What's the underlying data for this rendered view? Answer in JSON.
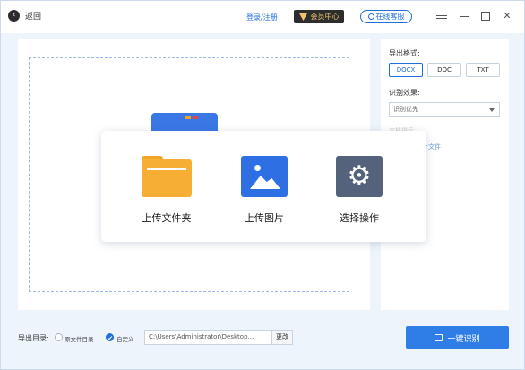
{
  "titlebar": {
    "back_label": "返回",
    "login_label": "登录/注册",
    "vip_label": "会员中心",
    "service_label": "在线客服"
  },
  "settings": {
    "export_format_label": "导出格式:",
    "formats": [
      "DOCX",
      "DOC",
      "TXT"
    ],
    "selected_format": "DOCX",
    "effect_label": "识别效果:",
    "effect_value": "识别优先",
    "partial_label": "文档提示",
    "partial_link": "个文件"
  },
  "popup": {
    "options": [
      {
        "label": "上传文件夹",
        "icon": "folder-icon"
      },
      {
        "label": "上传图片",
        "icon": "image-icon"
      },
      {
        "label": "选择操作",
        "icon": "gear-icon"
      }
    ]
  },
  "bottom": {
    "output_dir_label": "导出目录:",
    "radio_original": "原文件目录",
    "radio_custom": "自定义",
    "selected_radio": "自定义",
    "path_value": "C:\\Users\\Administrator\\Desktop...",
    "change_label": "更改",
    "recognize_label": "一键识别"
  },
  "colors": {
    "accent": "#1f6fd8",
    "folder": "#f7ae35",
    "image_icon": "#2f6fe4",
    "gear_icon": "#55627c",
    "vip_bg": "#2d2d2d",
    "vip_text": "#f0c36d"
  }
}
